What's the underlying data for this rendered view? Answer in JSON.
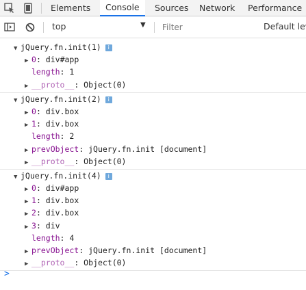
{
  "tabs": [
    {
      "label": "Elements"
    },
    {
      "label": "Console"
    },
    {
      "label": "Sources"
    },
    {
      "label": "Network"
    },
    {
      "label": "Performance"
    }
  ],
  "toolbar": {
    "context": "top",
    "filter_placeholder": "Filter",
    "levels_label": "Default lev"
  },
  "accent_color": "#1a73e8",
  "groups": [
    {
      "header": "jQuery.fn.init(1)",
      "rows": [
        {
          "expandable": true,
          "key": "0",
          "value": "div#app"
        },
        {
          "expandable": false,
          "key": "length",
          "value": "1"
        },
        {
          "expandable": true,
          "key": "__proto__",
          "value": "Object(0)",
          "dim": true
        }
      ]
    },
    {
      "header": "jQuery.fn.init(2)",
      "rows": [
        {
          "expandable": true,
          "key": "0",
          "value": "div.box"
        },
        {
          "expandable": true,
          "key": "1",
          "value": "div.box"
        },
        {
          "expandable": false,
          "key": "length",
          "value": "2"
        },
        {
          "expandable": true,
          "key": "prevObject",
          "value": "jQuery.fn.init [document]"
        },
        {
          "expandable": true,
          "key": "__proto__",
          "value": "Object(0)",
          "dim": true
        }
      ]
    },
    {
      "header": "jQuery.fn.init(4)",
      "rows": [
        {
          "expandable": true,
          "key": "0",
          "value": "div#app"
        },
        {
          "expandable": true,
          "key": "1",
          "value": "div.box"
        },
        {
          "expandable": true,
          "key": "2",
          "value": "div.box"
        },
        {
          "expandable": true,
          "key": "3",
          "value": "div"
        },
        {
          "expandable": false,
          "key": "length",
          "value": "4"
        },
        {
          "expandable": true,
          "key": "prevObject",
          "value": "jQuery.fn.init [document]"
        },
        {
          "expandable": true,
          "key": "__proto__",
          "value": "Object(0)",
          "dim": true
        }
      ]
    }
  ],
  "prompt_symbol": ">"
}
